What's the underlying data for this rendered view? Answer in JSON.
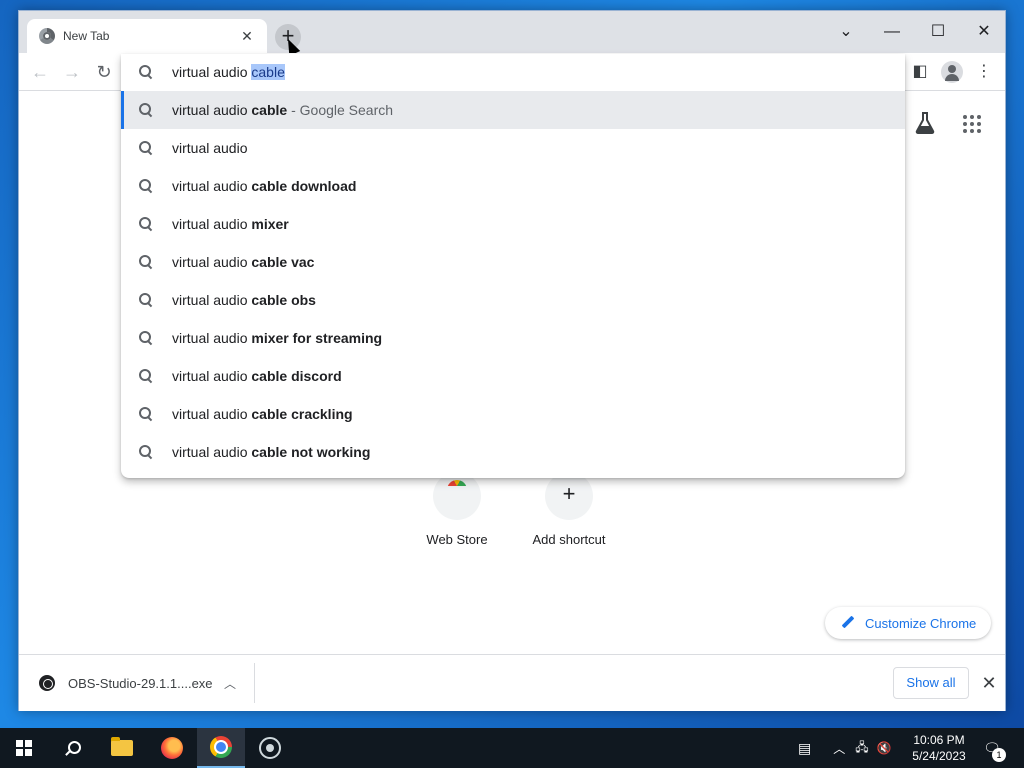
{
  "browser": {
    "tab": {
      "title": "New Tab"
    },
    "window_controls": {
      "tab_search": "⌄",
      "minimize": "—",
      "maximize": "☐",
      "close": "✕"
    }
  },
  "omnibox": {
    "typed": "virtual audio ",
    "autocomplete": "cable",
    "suggestions": [
      {
        "plain": "virtual audio ",
        "bold": "cable",
        "suffix": " - Google Search",
        "active": true
      },
      {
        "plain": "virtual audio",
        "bold": "",
        "suffix": "",
        "active": false
      },
      {
        "plain": "virtual audio ",
        "bold": "cable download",
        "suffix": "",
        "active": false
      },
      {
        "plain": "virtual audio ",
        "bold": "mixer",
        "suffix": "",
        "active": false
      },
      {
        "plain": "virtual audio ",
        "bold": "cable vac",
        "suffix": "",
        "active": false
      },
      {
        "plain": "virtual audio ",
        "bold": "cable obs",
        "suffix": "",
        "active": false
      },
      {
        "plain": "virtual audio ",
        "bold": "mixer for streaming",
        "suffix": "",
        "active": false
      },
      {
        "plain": "virtual audio ",
        "bold": "cable discord",
        "suffix": "",
        "active": false
      },
      {
        "plain": "virtual audio ",
        "bold": "cable crackling",
        "suffix": "",
        "active": false
      },
      {
        "plain": "virtual audio ",
        "bold": "cable not working",
        "suffix": "",
        "active": false
      }
    ]
  },
  "newtab": {
    "shortcuts": [
      {
        "label": "Web Store"
      },
      {
        "label": "Add shortcut"
      }
    ],
    "customize_label": "Customize Chrome"
  },
  "downloads": {
    "file_name": "OBS-Studio-29.1.1....exe",
    "show_all_label": "Show all"
  },
  "taskbar": {
    "time": "10:06 PM",
    "date": "5/24/2023",
    "notification_count": "1"
  },
  "colors": {
    "accent": "#1a73e8",
    "selection": "#a8c7fa",
    "taskbar": "#101820"
  }
}
